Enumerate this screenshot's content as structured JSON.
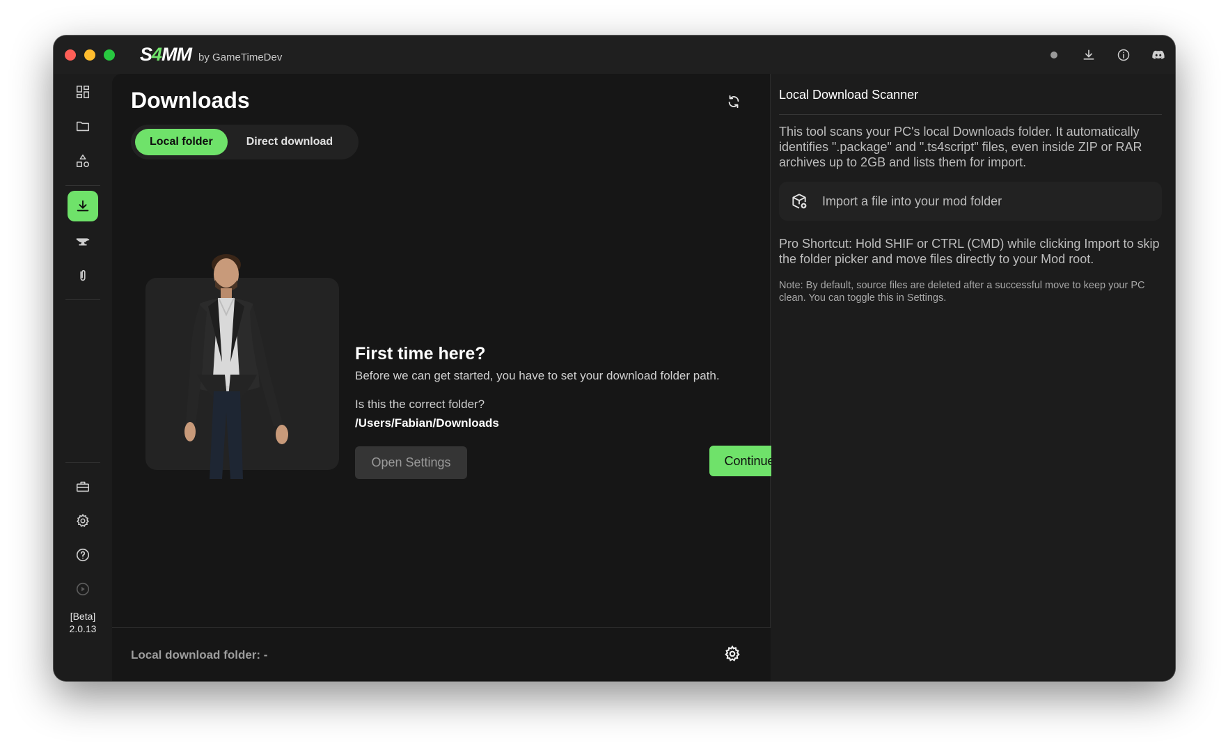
{
  "app": {
    "logo_prefix": "S",
    "logo_accent": "4",
    "logo_suffix": "MM",
    "byline": "by GameTimeDev",
    "version_label": "[Beta]",
    "version_number": "2.0.13"
  },
  "titlebar_icons": [
    "status-dot-icon",
    "download-icon",
    "info-icon",
    "discord-icon"
  ],
  "rail": {
    "top_items": [
      {
        "name": "dashboard",
        "icon": "grid-icon",
        "active": false
      },
      {
        "name": "mods-folder",
        "icon": "folder-icon",
        "active": false
      },
      {
        "name": "categories",
        "icon": "shapes-icon",
        "active": false
      },
      {
        "name": "downloads",
        "icon": "download-icon",
        "active": true
      },
      {
        "name": "anvil",
        "icon": "anvil-icon",
        "active": false
      },
      {
        "name": "attachments",
        "icon": "paperclip-icon",
        "active": false
      }
    ],
    "bottom_items": [
      {
        "name": "tools",
        "icon": "toolbox-icon"
      },
      {
        "name": "settings",
        "icon": "gear-icon"
      },
      {
        "name": "help",
        "icon": "help-icon"
      },
      {
        "name": "play",
        "icon": "play-icon"
      }
    ]
  },
  "main": {
    "title": "Downloads",
    "tabs": [
      {
        "label": "Local folder",
        "active": true
      },
      {
        "label": "Direct download",
        "active": false
      }
    ],
    "onboarding": {
      "title": "First time here?",
      "description": "Before we can get started, you have to set your download folder path.",
      "question": "Is this the correct folder?",
      "path": "/Users/Fabian/Downloads",
      "secondary_button": "Open Settings",
      "primary_button": "Continue"
    },
    "footer": {
      "label": "Local download folder: -"
    }
  },
  "side": {
    "title": "Local Download Scanner",
    "description": "This tool scans your PC's local Downloads folder. It automatically identifies \".package\" and \".ts4script\" files, even inside ZIP or RAR archives up to 2GB and lists them for import.",
    "import_button": "Import a file into your mod folder",
    "pro_tip": "Pro Shortcut: Hold SHIF or CTRL (CMD) while clicking Import to skip the folder picker and move files directly to your Mod root.",
    "note": "Note: By default, source files are deleted after a successful move to keep your PC clean. You can toggle this in Settings."
  },
  "colors": {
    "accent": "#6fe26a",
    "window_bg": "#1c1c1c",
    "panel_bg": "#161616"
  }
}
